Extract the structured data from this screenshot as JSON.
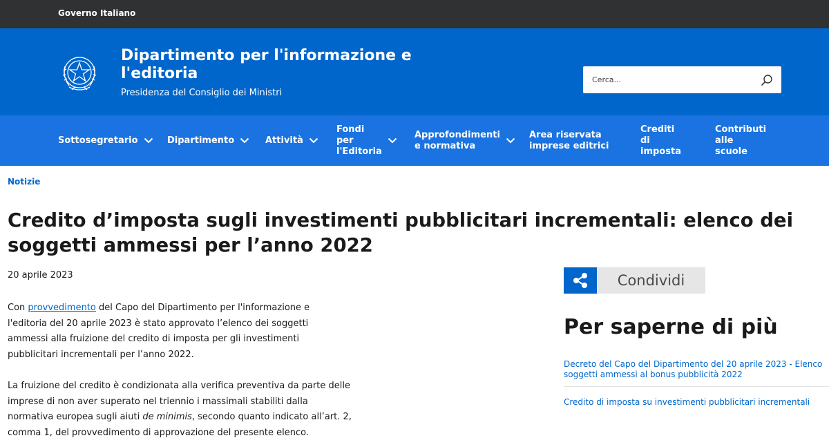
{
  "topbar": {
    "label": "Governo Italiano"
  },
  "header": {
    "title": "Dipartimento per l'informazione e l'editoria",
    "subtitle": "Presidenza del Consiglio dei Ministri",
    "search_placeholder": "Cerca...",
    "emblem_icon": "italian-republic-emblem-icon",
    "search_icon": "search-icon"
  },
  "nav": {
    "items": [
      {
        "label": "Sottosegretario",
        "has_dropdown": true
      },
      {
        "label": "Dipartimento",
        "has_dropdown": true
      },
      {
        "label": "Attività",
        "has_dropdown": true
      },
      {
        "label": "Fondi\nper\nl'Editoria",
        "has_dropdown": true
      },
      {
        "label": "Approfondimenti\ne normativa",
        "has_dropdown": true
      },
      {
        "label": "Area riservata\nimprese editrici",
        "has_dropdown": false
      },
      {
        "label": "Crediti\ndi\nimposta",
        "has_dropdown": false
      },
      {
        "label": "Contributi\nalle\nscuole",
        "has_dropdown": false
      }
    ]
  },
  "breadcrumb": "Notizie",
  "article": {
    "title": "Credito d’imposta sugli investimenti pubblicitari incrementali: elenco dei soggetti ammessi per l’anno 2022",
    "date": "20 aprile 2023",
    "p1_before": "Con ",
    "p1_link": "provvedimento",
    "p1_after": " del Capo del Dipartimento per l'informazione e l'editoria del 20 aprile 2023 è stato approvato l’elenco dei soggetti ammessi alla fruizione del credito di imposta per gli investimenti pubblicitari incrementali per l’anno 2022.",
    "p2_before": "La fruizione del credito è condizionata alla verifica preventiva da parte delle imprese di non aver superato nel triennio i massimali stabiliti dalla normativa europea sugli aiuti ",
    "p2_em": "de minimis",
    "p2_after": ", secondo quanto indicato all’art. 2, comma 1, del provvedimento di approvazione del presente elenco."
  },
  "sidebar": {
    "share_label": "Condividi",
    "share_icon": "share-icon",
    "more_title": "Per saperne di più",
    "links": [
      "Decreto del Capo del Dipartimento del 20 aprile 2023 - Elenco soggetti ammessi al bonus pubblicità 2022",
      "Credito di imposta su investimenti pubblicitari incrementali"
    ]
  },
  "colors": {
    "topbar": "#2f3133",
    "header": "#0066cc",
    "nav": "#1a73e0",
    "link": "#0066cc",
    "share_bg": "#e6e6e6"
  }
}
